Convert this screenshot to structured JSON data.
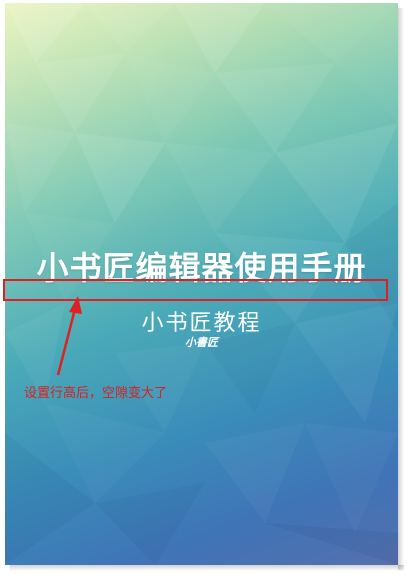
{
  "cover": {
    "title": "小书匠编辑器使用手册",
    "subtitle": "小书匠教程",
    "signature": "小書匠"
  },
  "annotation": {
    "text": "设置行高后，空隙变大了",
    "color": "#e02020"
  }
}
